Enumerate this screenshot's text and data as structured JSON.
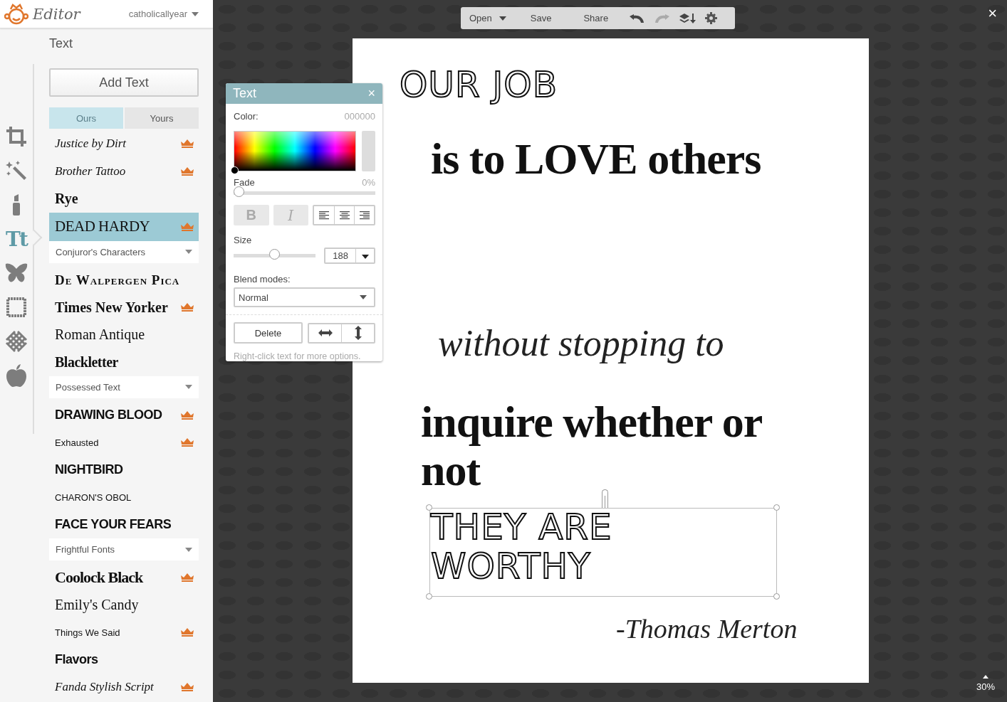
{
  "header": {
    "logo_text": "Editor",
    "account": "catholicallyear"
  },
  "tools": [
    {
      "kind": "crop",
      "selected": false
    },
    {
      "kind": "wand",
      "selected": false
    },
    {
      "kind": "lipstick",
      "selected": false
    },
    {
      "kind": "text",
      "label": "Tt",
      "selected": true
    },
    {
      "kind": "butterfly",
      "selected": false
    },
    {
      "kind": "frame",
      "selected": false
    },
    {
      "kind": "texture",
      "selected": false
    },
    {
      "kind": "apple",
      "selected": false
    }
  ],
  "panel": {
    "title": "Text",
    "add_button": "Add Text",
    "tabs": [
      {
        "label": "Ours",
        "selected": true
      },
      {
        "label": "Yours",
        "selected": false
      }
    ],
    "fonts": [
      {
        "kind": "script",
        "name": "Justice by Dirt",
        "premium": true,
        "selected": false
      },
      {
        "kind": "script",
        "name": "Brother Tattoo",
        "premium": true,
        "selected": false
      },
      {
        "kind": "slab",
        "name": "Rye",
        "premium": false,
        "selected": false
      },
      {
        "kind": "decor",
        "name": "DEAD HARDY",
        "premium": true,
        "selected": true
      },
      {
        "kind": "group",
        "name": "Conjuror's Characters"
      },
      {
        "kind": "smallcaps",
        "name": "De Walpergen Pica",
        "premium": false,
        "selected": false
      },
      {
        "kind": "slab",
        "name": "Times New Yorker",
        "premium": true,
        "selected": false
      },
      {
        "kind": "serif",
        "name": "Roman Antique",
        "premium": false,
        "selected": false
      },
      {
        "kind": "blackletter",
        "name": "Blackletter",
        "premium": false,
        "selected": false
      },
      {
        "kind": "group",
        "name": "Possessed Text"
      },
      {
        "kind": "grunge",
        "name": "DRAWING BLOOD",
        "premium": true,
        "selected": false
      },
      {
        "kind": "small",
        "name": "Exhausted",
        "premium": true,
        "selected": false
      },
      {
        "kind": "grunge",
        "name": "NIGHTBIRD",
        "premium": false,
        "selected": false
      },
      {
        "kind": "small",
        "name": "CHARON'S OBOL",
        "premium": false,
        "selected": false
      },
      {
        "kind": "grunge",
        "name": "FACE YOUR FEARS",
        "premium": false,
        "selected": false
      },
      {
        "kind": "group",
        "name": "Frightful Fonts"
      },
      {
        "kind": "condensed",
        "name": "Coolock Black",
        "premium": true,
        "selected": false
      },
      {
        "kind": "serif",
        "name": "Emily's Candy",
        "premium": false,
        "selected": false
      },
      {
        "kind": "small",
        "name": "Things We Said",
        "premium": true,
        "selected": false
      },
      {
        "kind": "grunge",
        "name": "Flavors",
        "premium": false,
        "selected": false
      },
      {
        "kind": "script",
        "name": "Fanda Stylish Script",
        "premium": true,
        "selected": false
      }
    ]
  },
  "toolbar": {
    "open": "Open",
    "save": "Save",
    "share": "Share",
    "undo_disabled": false,
    "redo_disabled": true
  },
  "text_dialog": {
    "title": "Text",
    "close": "×",
    "color_label": "Color:",
    "color_value": "000000",
    "fade": {
      "label": "Fade",
      "value": "0%",
      "level": 0
    },
    "bold": "B",
    "italic": "I",
    "size": {
      "label": "Size",
      "level": 0.5,
      "value": "188"
    },
    "blend_label": "Blend modes:",
    "blend_value": "Normal",
    "delete": "Delete",
    "hint": "Right-click text for more options."
  },
  "canvas": {
    "texts": [
      {
        "kind": "outline",
        "text": "OUR JOB",
        "selected": false
      },
      {
        "kind": "bold",
        "text": "is to LOVE others",
        "selected": false
      },
      {
        "kind": "script",
        "text": "without stopping to",
        "selected": false
      },
      {
        "kind": "bold",
        "text": "inquire whether or not",
        "selected": false
      },
      {
        "kind": "outline",
        "text": "THEY ARE WORTHY",
        "selected": true
      },
      {
        "kind": "signature",
        "text": "-Thomas Merton",
        "selected": false
      }
    ]
  },
  "close": "×",
  "zoom": "30%"
}
